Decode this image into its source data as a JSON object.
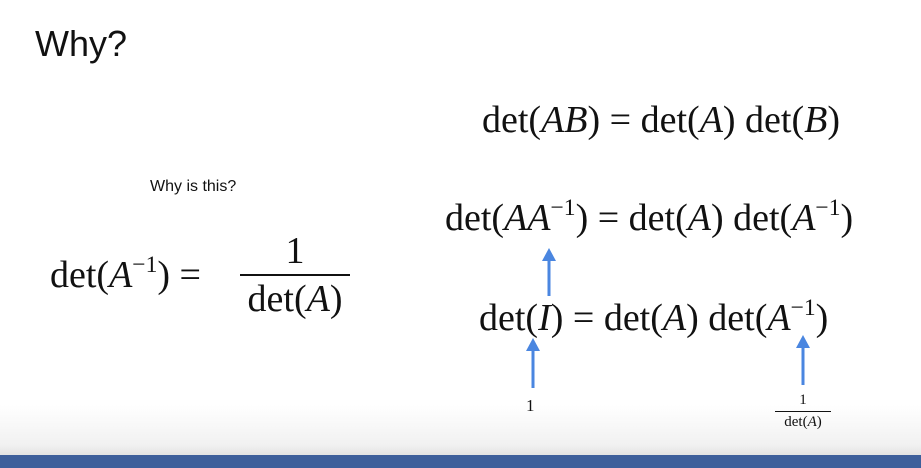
{
  "slide": {
    "title": "Why?",
    "caption": "Why is this?"
  },
  "left_equation": {
    "lhs_fn": "det(",
    "lhs_var": "A",
    "lhs_sup": "−1",
    "lhs_close": ") =",
    "numerator": "1",
    "den_fn": "det(",
    "den_var": "A",
    "den_close": ")"
  },
  "eq1": {
    "p1": "det(",
    "v1": "AB",
    "p2": ") = det(",
    "v2": "A",
    "p3": ") det(",
    "v3": "B",
    "p4": ")"
  },
  "eq2": {
    "p1": "det(",
    "v1": "AA",
    "s1": "−1",
    "p2": ") = det(",
    "v2": "A",
    "p3": ") det(",
    "v3": "A",
    "s2": "−1",
    "p4": ")"
  },
  "eq3": {
    "p1": "det(",
    "v1": "I",
    "p2": ") = det(",
    "v2": "A",
    "p3": ") det(",
    "v3": "A",
    "s1": "−1",
    "p4": ")"
  },
  "annotations": {
    "one_label": "1",
    "frac_num": "1",
    "frac_den_fn": "det(",
    "frac_den_var": "A",
    "frac_den_close": ")"
  },
  "colors": {
    "arrow": "#4a86e0",
    "bottom_bar": "#3d5f9b"
  },
  "icons": [
    "up-arrow-icon"
  ]
}
